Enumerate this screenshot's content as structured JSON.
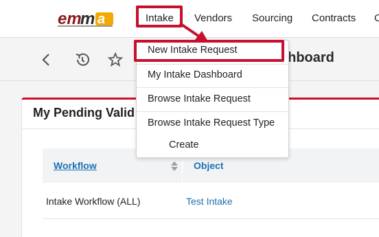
{
  "brand": {
    "logo_text": "emma",
    "accent": "#c8102e"
  },
  "nav": {
    "items": [
      {
        "label": "Intake"
      },
      {
        "label": "Vendors"
      },
      {
        "label": "Sourcing"
      },
      {
        "label": "Contracts"
      },
      {
        "label": "C"
      }
    ]
  },
  "toolbar": {
    "icons": [
      "back-icon",
      "history-icon",
      "star-icon"
    ],
    "page_title_partial": "shboard"
  },
  "dropdown": {
    "items": [
      {
        "label": "New Intake Request"
      },
      {
        "label": "My Intake Dashboard"
      },
      {
        "label": "Browse Intake Request"
      },
      {
        "label": "Browse Intake Request Type"
      },
      {
        "label": "Create"
      }
    ]
  },
  "card": {
    "title": "My Pending Valid",
    "table": {
      "headers": {
        "workflow": "Workflow",
        "object": "Object"
      },
      "rows": [
        {
          "workflow": "Intake Workflow (ALL)",
          "object": "Test Intake"
        }
      ]
    }
  },
  "colors": {
    "highlight": "#c8102e",
    "link": "#1f6fb2"
  }
}
